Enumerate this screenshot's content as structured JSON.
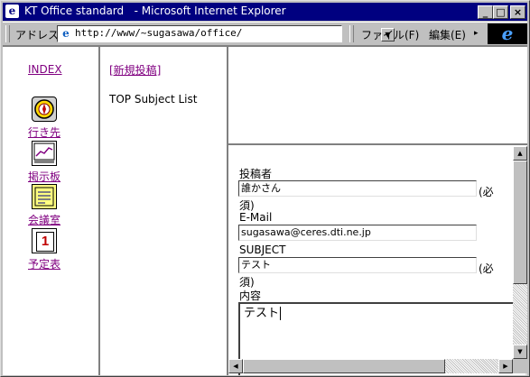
{
  "window": {
    "title_app": "KT Office standard",
    "title_browser": "- Microsoft Internet Explorer",
    "minimize": "_",
    "maximize": "□",
    "close": "×"
  },
  "toolbar": {
    "address_label": "アドレス",
    "url": "http://www/~sugasawa/office/",
    "menu_file": "ファイル(F)",
    "menu_edit": "編集(E)",
    "menu_more": "▸"
  },
  "nav": {
    "index": "INDEX",
    "items": [
      {
        "label": "行き先",
        "icon": "compass-icon"
      },
      {
        "label": "掲示板",
        "icon": "chart-board-icon"
      },
      {
        "label": "会議室",
        "icon": "notebook-icon"
      },
      {
        "label": "予定表",
        "icon": "calendar-icon",
        "icon_text": "1"
      }
    ]
  },
  "middle": {
    "new_post_link": "[新規投稿]",
    "subject_list": "TOP Subject List"
  },
  "form": {
    "author_label": "投稿者",
    "author_value": "誰かさん",
    "required_a": "(必",
    "required_b": "須)",
    "email_label": "E-Mail",
    "email_value": "sugasawa@ceres.dti.ne.jp",
    "subject_label": "SUBJECT",
    "subject_value": "テスト",
    "required2_a": "(必",
    "required2_b": "須)",
    "content_label": "内容",
    "content_value": "テスト"
  },
  "colors": {
    "titlebar": "#000080",
    "link_visited": "#800080"
  }
}
